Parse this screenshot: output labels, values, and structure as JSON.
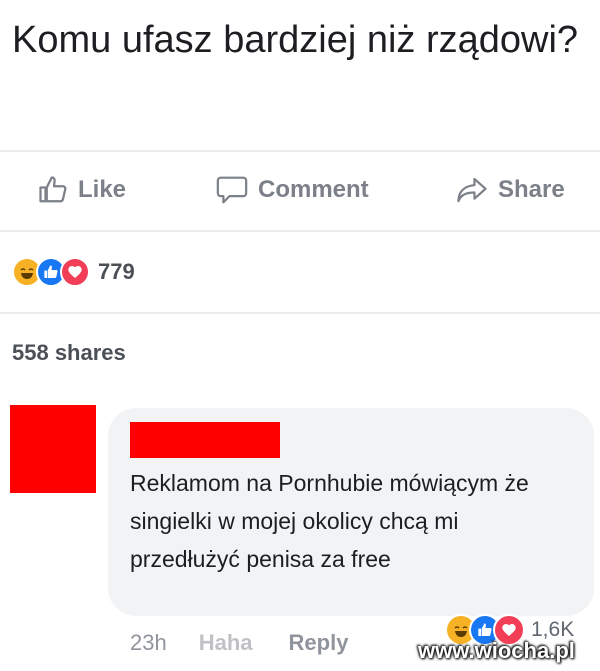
{
  "post": {
    "text": "Komu ufasz bardziej niż rządowi?"
  },
  "actions": {
    "like": "Like",
    "comment": "Comment",
    "share": "Share"
  },
  "reactions": {
    "icons": [
      "haha-icon",
      "like-icon",
      "love-icon"
    ],
    "count": "779"
  },
  "shares": "558 shares",
  "comment": {
    "text": "Reklamom na Pornhubie mówiącym że singielki w mojej okolicy chcą mi przedłużyć penisa za free",
    "time": "23h",
    "haha": "Haha",
    "reply": "Reply",
    "reaction_count": "1,6K"
  },
  "watermark": "www.wiocha.pl",
  "colors": {
    "redaction": "#ff0000",
    "bubble": "#f2f3f5",
    "action_text": "#7c8088",
    "like_blue": "#1877f2",
    "love_red": "#f33e58",
    "haha_yellow": "#f7b125"
  }
}
